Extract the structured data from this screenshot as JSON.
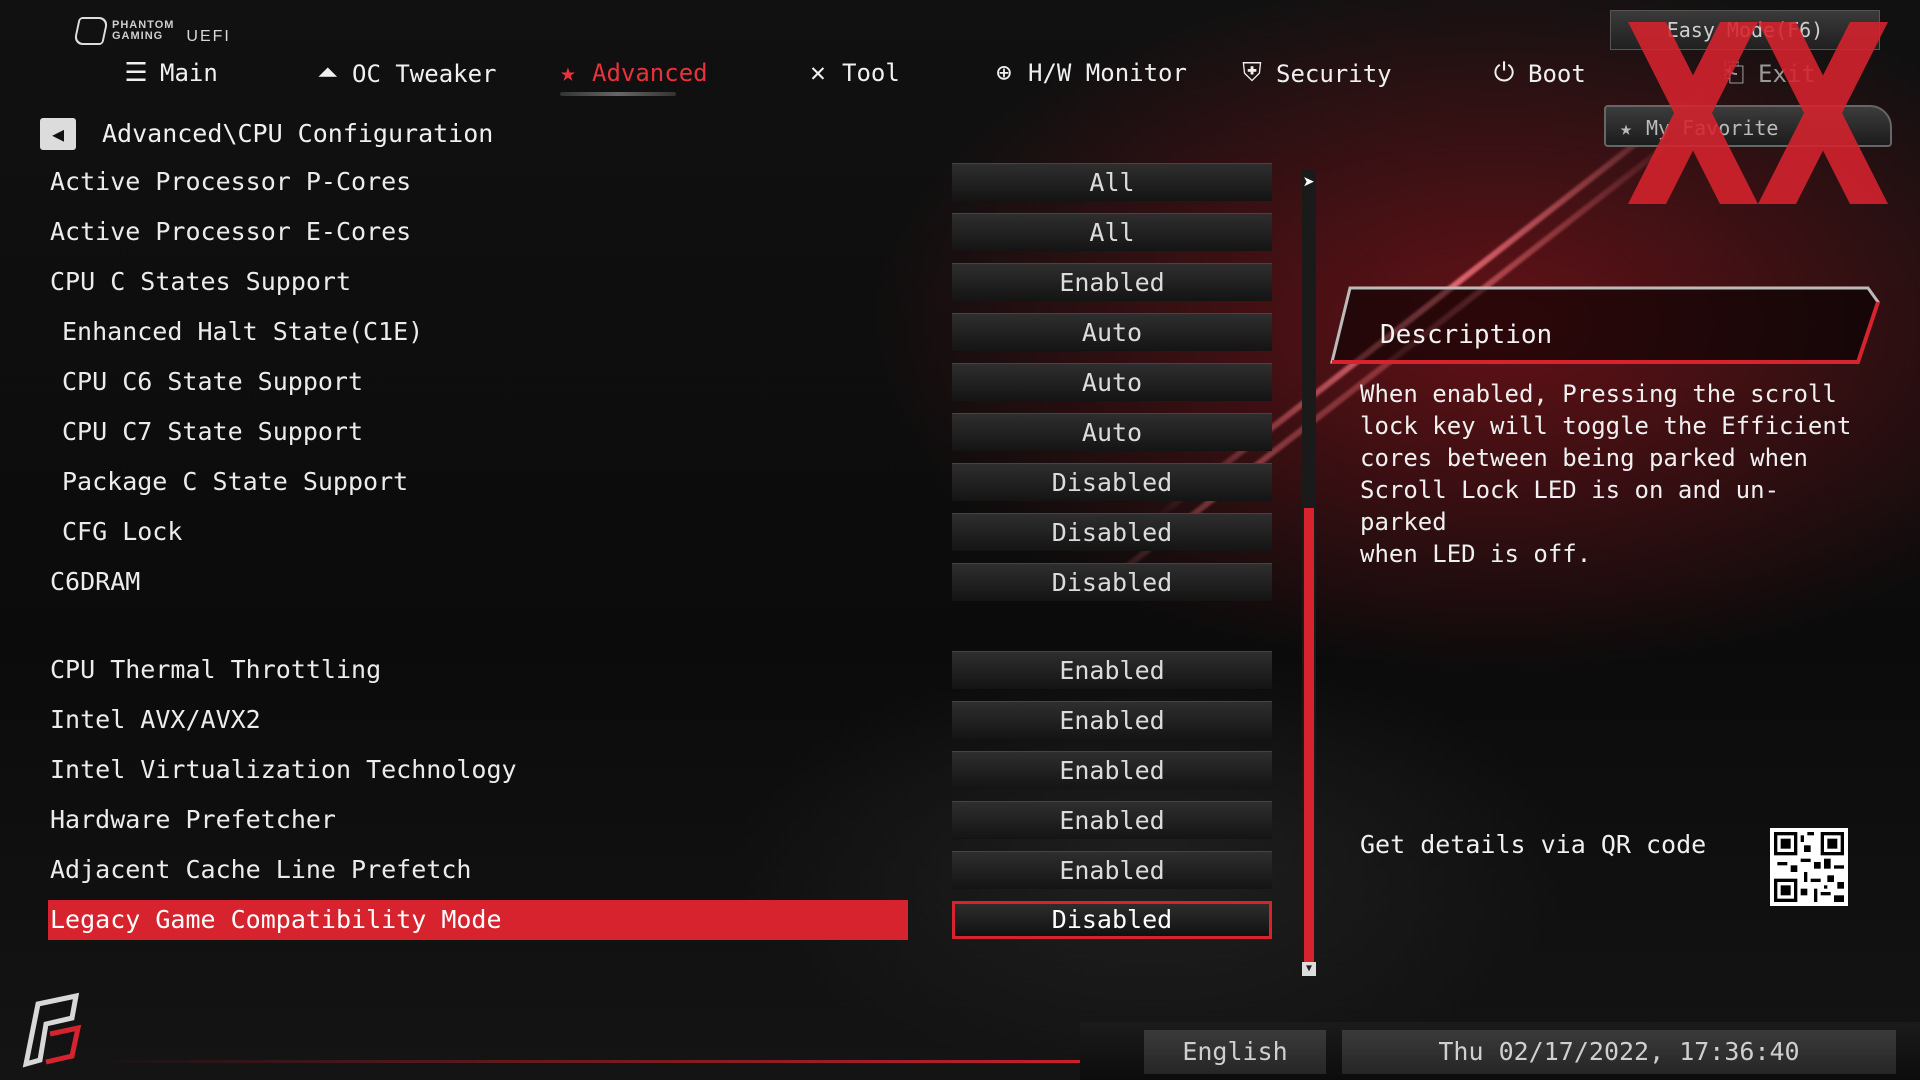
{
  "brand": {
    "line1": "PHANTOM",
    "line2": "GAMING",
    "uefi": "UEFI"
  },
  "easy_mode_label": "Easy Mode(F6)",
  "nav": [
    {
      "label": "Main",
      "icon": "list-icon",
      "active": false
    },
    {
      "label": "OC Tweaker",
      "icon": "rocket-icon",
      "active": false
    },
    {
      "label": "Advanced",
      "icon": "star-icon",
      "active": true
    },
    {
      "label": "Tool",
      "icon": "tools-icon",
      "active": false
    },
    {
      "label": "H/W Monitor",
      "icon": "crosshair-icon",
      "active": false
    },
    {
      "label": "Security",
      "icon": "shield-icon",
      "active": false
    },
    {
      "label": "Boot",
      "icon": "power-icon",
      "active": false
    },
    {
      "label": "Exit",
      "icon": "exit-icon",
      "active": false
    }
  ],
  "favorite_label": "My Favorite",
  "breadcrumb": "Advanced\\CPU Configuration",
  "settings": [
    {
      "label": "Active Processor P-Cores",
      "value": "All",
      "sub": false
    },
    {
      "label": "Active Processor E-Cores",
      "value": "All",
      "sub": false
    },
    {
      "label": "CPU C States Support",
      "value": "Enabled",
      "sub": false
    },
    {
      "label": "Enhanced Halt State(C1E)",
      "value": "Auto",
      "sub": true
    },
    {
      "label": "CPU C6 State Support",
      "value": "Auto",
      "sub": true
    },
    {
      "label": "CPU C7 State Support",
      "value": "Auto",
      "sub": true
    },
    {
      "label": "Package C State Support",
      "value": "Disabled",
      "sub": true
    },
    {
      "label": "CFG Lock",
      "value": "Disabled",
      "sub": true
    },
    {
      "label": "C6DRAM",
      "value": "Disabled",
      "sub": false
    },
    {
      "label": "CPU Thermal Throttling",
      "value": "Enabled",
      "sub": false
    },
    {
      "label": "Intel AVX/AVX2",
      "value": "Enabled",
      "sub": false
    },
    {
      "label": "Intel Virtualization Technology",
      "value": "Enabled",
      "sub": false
    },
    {
      "label": "Hardware Prefetcher",
      "value": "Enabled",
      "sub": false
    },
    {
      "label": "Adjacent Cache Line Prefetch",
      "value": "Enabled",
      "sub": false
    },
    {
      "label": "Legacy Game Compatibility Mode",
      "value": "Disabled",
      "sub": false,
      "selected": true
    }
  ],
  "description": {
    "title": "Description",
    "text": "When enabled, Pressing the scroll\nlock key will toggle the Efficient\ncores between being parked when\nScroll Lock LED is on and un-parked\nwhen LED is off."
  },
  "qr_label": "Get details via QR code",
  "footer": {
    "language": "English",
    "datetime": "Thu 02/17/2022, 17:36:40"
  },
  "colors": {
    "accent": "#d7232e",
    "text": "#ececec",
    "value_bg": "#1e1e1e"
  }
}
